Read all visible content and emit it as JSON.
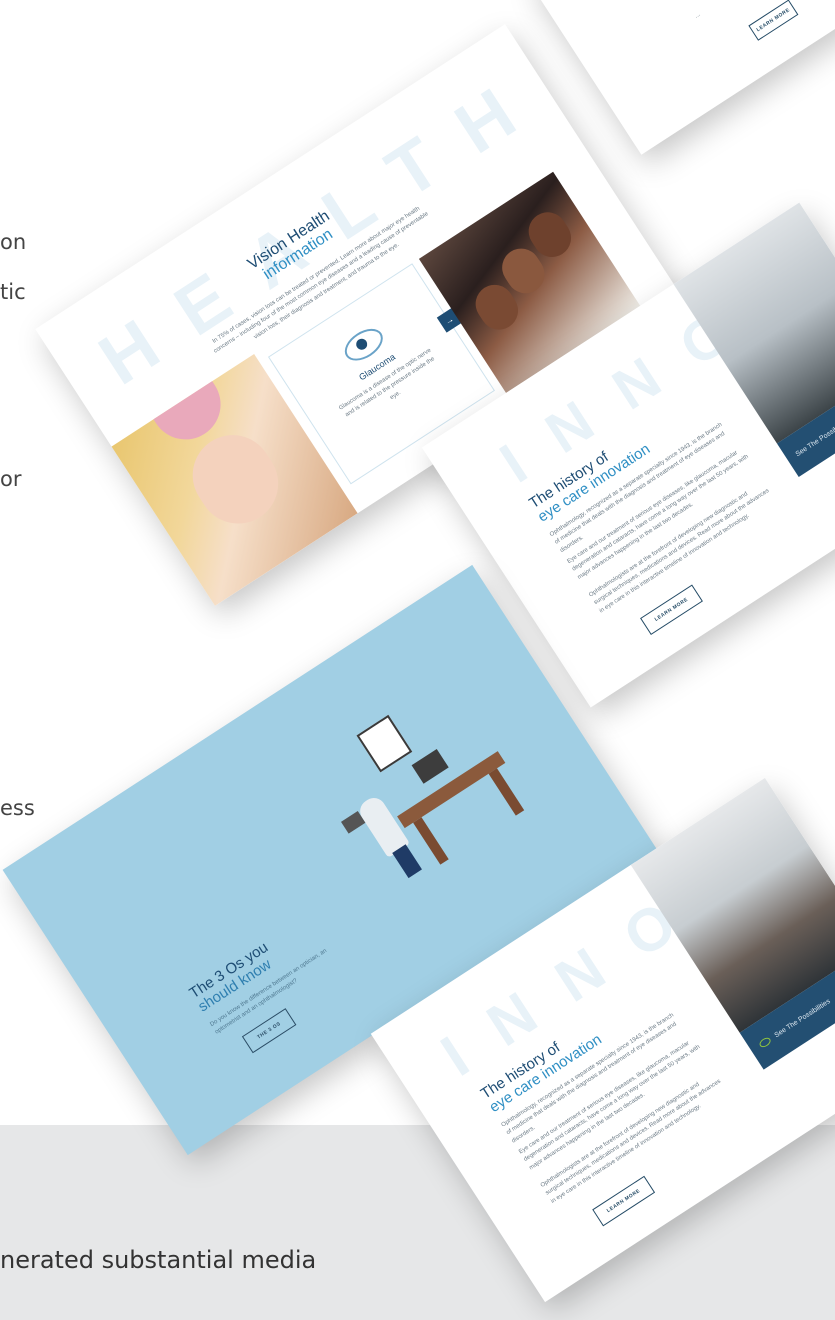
{
  "background": {
    "side_fragments": [
      "on",
      "tic",
      "or",
      "ess"
    ],
    "bottom_fragment": "nerated substantial media"
  },
  "cards": {
    "top_partial": {
      "button": "LEARN MORE"
    },
    "health": {
      "watermark": "HEALTH",
      "title_line1": "Vision Health",
      "title_line2": "information",
      "intro": "In 75% of cases, vision loss can be treated or prevented. Learn more about major eye health concerns – including four of the most common eye diseases and a leading cause of preventable vision loss, their diagnosis and treatment, and trauma to the eye.",
      "feature_title": "Glaucoma",
      "feature_text": "Glaucoma is a disease of the optic nerve and is related to the pressure inside the eye.",
      "arrow": "→"
    },
    "innovation": {
      "watermark": "INNOVATION",
      "title_line1": "The history of",
      "title_line2": "eye care innovation",
      "para1": "Ophthalmology, recognized as a separate specialty since 1943, is the branch of medicine that deals with the diagnosis and treatment of eye diseases and disorders.",
      "para2": "Eye care and our treatment of serious eye diseases, like glaucoma, macular degeneration and cataracts, have come a long way over the last 50 years, with major advances happening in the last two decades.",
      "para3": "Ophthalmologists are at the forefront of developing new diagnostic and surgical techniques, medications and devices. Read more about the advances in eye care in this interactive timeline of innovation and technology.",
      "button": "LEARN MORE",
      "panel_label": "See The Possibilities"
    },
    "three_os": {
      "title_line1": "The 3 Os you",
      "title_line2": "should know",
      "text": "Do you know the difference between an optician, an optometrist and an ophthalmologist?",
      "button": "THE 3 OS"
    },
    "innovation2": {
      "watermark": "INNOVATION",
      "title_line1": "The history of",
      "title_line2": "eye care innovation",
      "para1": "Ophthalmology, recognized as a separate specialty since 1943, is the branch of medicine that deals with the diagnosis and treatment of eye diseases and disorders.",
      "para2": "Eye care and our treatment of serious eye diseases, like glaucoma, macular degeneration and cataracts, have come a long way over the last 50 years, with major advances happening in the last two decades.",
      "para3": "Ophthalmologists are at the forefront of developing new diagnostic and surgical techniques, medications and devices. Read more about the advances in eye care in this interactive timeline of innovation and technology.",
      "button": "LEARN MORE",
      "panel_label": "See The Possibilities"
    }
  },
  "colors": {
    "brand_navy": "#1e4d74",
    "brand_blue": "#2f8fc4",
    "sky_card": "#a1cfe4",
    "band_gray": "#e6e7e8"
  }
}
